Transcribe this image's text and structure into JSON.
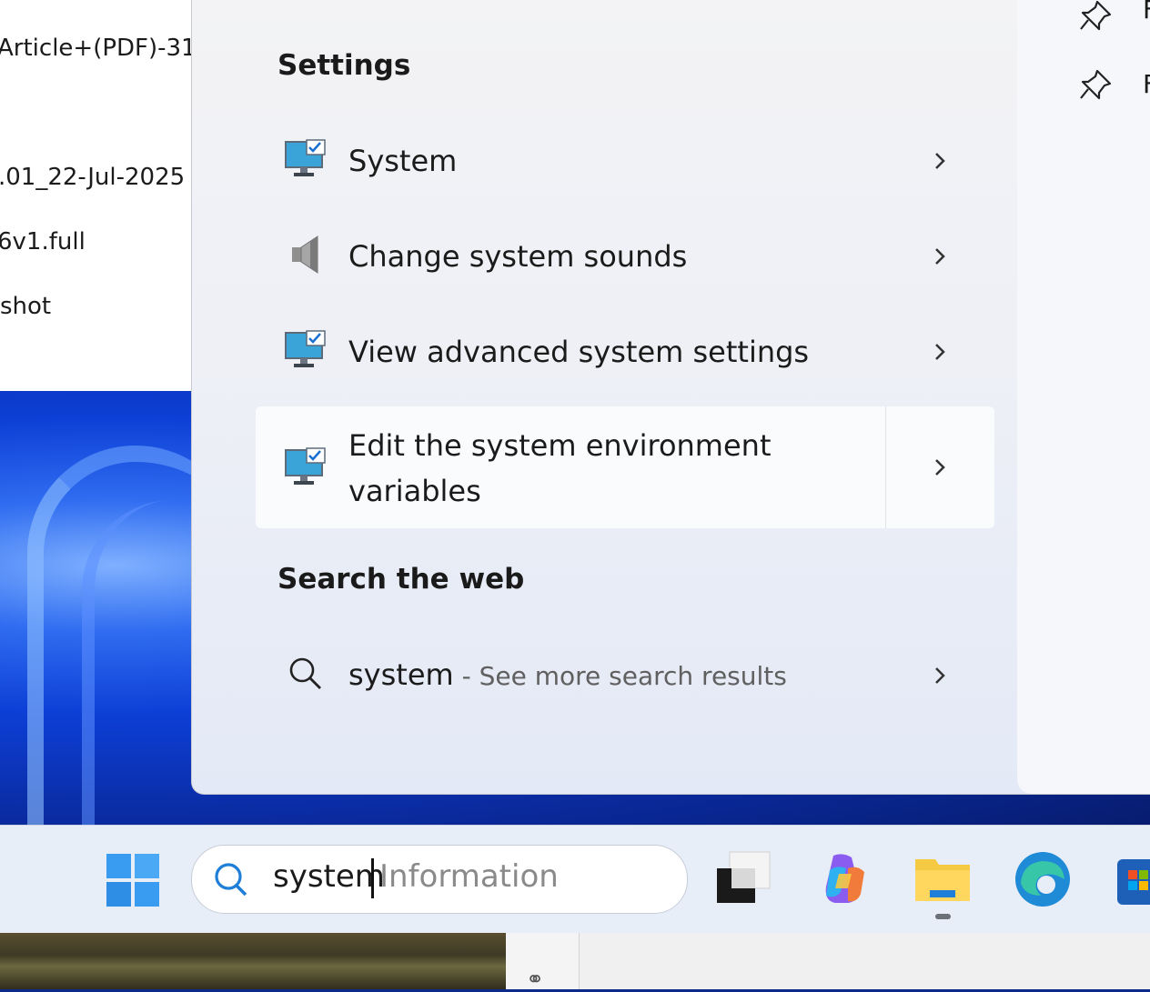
{
  "explorer": {
    "files": [
      "Article+(PDF)-31",
      ".01_22-Jul-2025",
      "6v1.full",
      "shot"
    ]
  },
  "start_menu": {
    "settings_title": "Settings",
    "items": [
      {
        "label": "System",
        "icon": "monitor-check-icon"
      },
      {
        "label": "Change system sounds",
        "icon": "speaker-icon"
      },
      {
        "label": "View advanced system settings",
        "icon": "monitor-check-icon"
      },
      {
        "label_line1": "Edit the system environment",
        "label_line2": "variables",
        "icon": "monitor-check-icon"
      }
    ],
    "web_title": "Search the web",
    "web": {
      "query": "system",
      "suffix": " - See more search results",
      "icon": "search-icon"
    },
    "right_pins": [
      {
        "letter": "F"
      },
      {
        "letter": "F"
      }
    ]
  },
  "taskbar": {
    "search": {
      "typed": "system",
      "suggestion": "Information"
    },
    "apps": [
      "start-button",
      "task-view",
      "copilot",
      "file-explorer",
      "edge",
      "store"
    ]
  },
  "bottom": {
    "mid_glyph": "⚭"
  },
  "colors": {
    "accent": "#0067c0",
    "folder": "#f6c943",
    "edge": "#1f8ad6"
  }
}
